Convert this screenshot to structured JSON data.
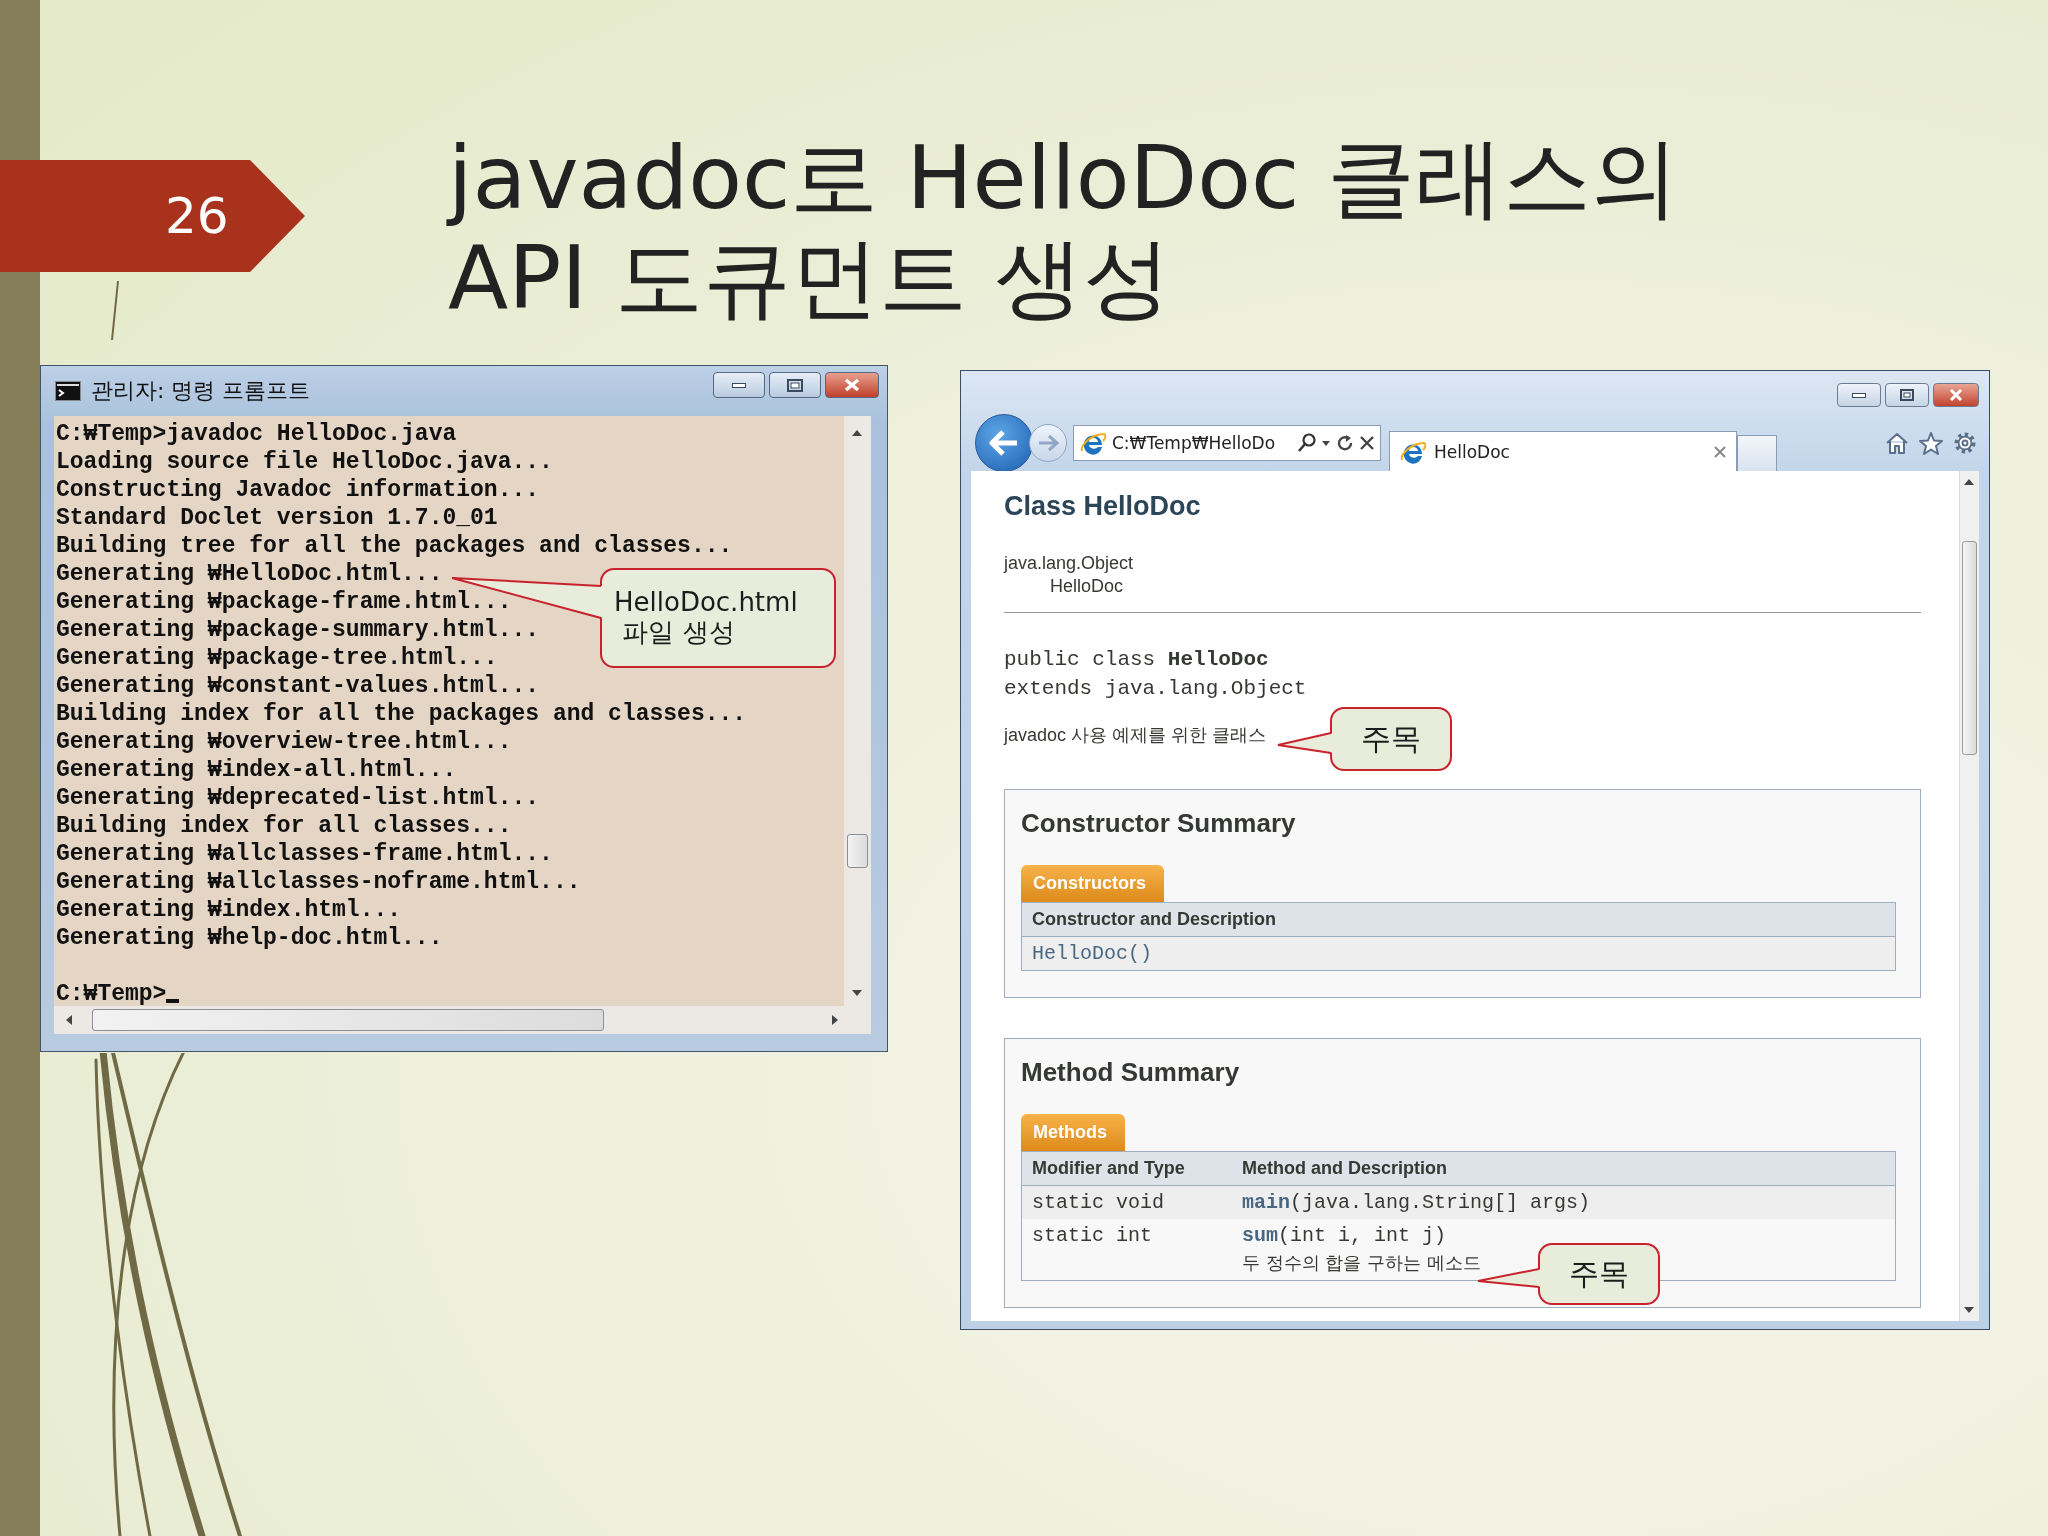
{
  "slide": {
    "number": "26",
    "title": "javadoc로 HelloDoc 클래스의 API 도큐먼트 생성"
  },
  "console": {
    "title": "관리자: 명령 프롬프트",
    "output": [
      "C:₩Temp>javadoc HelloDoc.java",
      "Loading source file HelloDoc.java...",
      "Constructing Javadoc information...",
      "Standard Doclet version 1.7.0_01",
      "Building tree for all the packages and classes...",
      "Generating ₩HelloDoc.html...",
      "Generating ₩package-frame.html...",
      "Generating ₩package-summary.html...",
      "Generating ₩package-tree.html...",
      "Generating ₩constant-values.html...",
      "Building index for all the packages and classes...",
      "Generating ₩overview-tree.html...",
      "Generating ₩index-all.html...",
      "Generating ₩deprecated-list.html...",
      "Building index for all classes...",
      "Generating ₩allclasses-frame.html...",
      "Generating ₩allclasses-noframe.html...",
      "Generating ₩index.html...",
      "Generating ₩help-doc.html..."
    ],
    "prompt": "C:₩Temp>"
  },
  "console_callout": {
    "text": "HelloDoc.html\n 파일 생성"
  },
  "browser": {
    "address": "C:₩Temp₩HelloDo",
    "tabs": [
      {
        "label": "HelloDoc",
        "selected": true
      }
    ],
    "page": {
      "heading": "Class HelloDoc",
      "inheritance": [
        "java.lang.Object",
        "HelloDoc"
      ],
      "signature": [
        "public class **HelloDoc**",
        "extends java.lang.Object"
      ],
      "description": "javadoc 사용 예제를 위한 클래스",
      "constructor_summary": {
        "title": "Constructor Summary",
        "tab": "Constructors",
        "columns": [
          "Constructor and Description"
        ],
        "rows": [
          {
            "name": "HelloDoc()"
          }
        ]
      },
      "method_summary": {
        "title": "Method Summary",
        "tab": "Methods",
        "columns": [
          "Modifier and Type",
          "Method and Description"
        ],
        "rows": [
          {
            "type": "static void",
            "name": "main",
            "params": "(java.lang.String[] args)"
          },
          {
            "type": "static int",
            "name": "sum",
            "params": "(int i, int j)",
            "description": "두 정수의 합을 구하는 메소드"
          }
        ]
      }
    }
  },
  "page_callouts": [
    {
      "text": "주목"
    },
    {
      "text": "주목"
    }
  ]
}
